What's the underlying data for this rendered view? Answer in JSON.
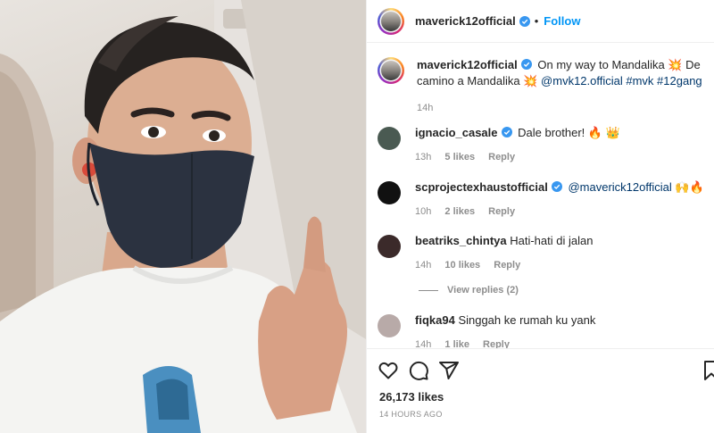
{
  "post": {
    "author": "maverick12official",
    "follow_label": "Follow",
    "separator": "•",
    "caption_text": "On my way to Mandalika 💥 De camino a Mandalika 💥",
    "caption_tags": "@mvk12.official #mvk #12gang",
    "caption_time": "14h"
  },
  "comments": [
    {
      "user": "ignacio_casale",
      "verified": true,
      "text": "Dale brother! 🔥 👑",
      "time": "13h",
      "likes": "5 likes",
      "reply": "Reply",
      "avatar_color": "#4a5a52"
    },
    {
      "user": "scprojectexhaustofficial",
      "verified": true,
      "mention": "@maverick12official",
      "text": " 🙌🔥",
      "time": "10h",
      "likes": "2 likes",
      "reply": "Reply",
      "avatar_color": "#111111"
    },
    {
      "user": "beatriks_chintya",
      "verified": false,
      "text": "Hati-hati di jalan",
      "time": "14h",
      "likes": "10 likes",
      "reply": "Reply",
      "avatar_color": "#3b2a2a"
    },
    {
      "user": "fiqka94",
      "verified": false,
      "text": "Singgah ke rumah ku yank",
      "time": "14h",
      "likes": "1 like",
      "reply": "Reply",
      "avatar_color": "#b8aaa8"
    }
  ],
  "view_replies": "View replies (2)",
  "likes_total": "26,173 likes",
  "posted_ago": "14 HOURS AGO",
  "accent": "#0095f6",
  "icons": [
    "heart-icon",
    "comment-icon",
    "share-icon",
    "bookmark-icon",
    "more-icon",
    "verified-icon"
  ]
}
